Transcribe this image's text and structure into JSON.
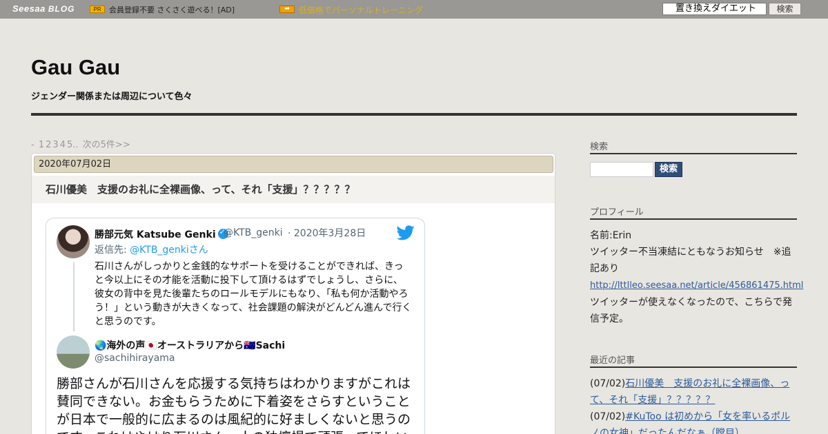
{
  "topbar": {
    "logo_main": "Seesaa",
    "logo_blog": "BLOG",
    "pr_badge": "PR",
    "pr_text": "会員登録不要 さくさく遊べる！[AD]",
    "arrow_badge": "➡",
    "arrow_link": "低価格でパーソナルトレーニング",
    "search_value": "置き換えダイエット",
    "search_button": "検索"
  },
  "header": {
    "title": "Gau Gau",
    "description": "ジェンダー関係または周辺について色々"
  },
  "pager": {
    "dash": "-",
    "pages": [
      "1",
      "2",
      "3",
      "4",
      "5.."
    ],
    "next": "次の5件>>"
  },
  "article": {
    "date": "2020年07月02日",
    "title": "石川優美　支援のお礼に全裸画像、って、それ「支援」？？？？？",
    "tweet": {
      "name": "勝部元気 Katsube Genki",
      "handle": "@KTB_genki",
      "date": "· 2020年3月28日",
      "reply_prefix": "返信先: ",
      "reply_handle": "@KTB_genkiさん",
      "quote_text": "石川さんがしっかりと金銭的なサポートを受けることができれば、きっと今以上にその才能を活動に投下して頂けるはずでしょうし、さらに、彼女の背中を見た後輩たちのロールモデルにもなり、「私も何か活動やろう！」という動きが大きくなって、社会課題の解決がどんどん進んで行くと思うのです。",
      "reply_name": "🌏海外の声🇯🇵オーストラリアから🇦🇺Sachi",
      "reply_user": "@sachihirayama",
      "main_text": "勝部さんが石川さんを応援する気持ちはわかりますがこれは賛同できない。お金もらうために下着姿をさらすということが日本で一般的に広まるのは風紀的に好ましくないと思うのです。これはやはり石川さん一人の独壇場で頑張ってほしい"
    }
  },
  "sidebar": {
    "search_heading": "検索",
    "search_button": "検索",
    "profile_heading": "プロフィール",
    "profile_name": "名前:Erin",
    "profile_notice": "ツイッター不当凍結にともなうお知らせ　※追記あり",
    "profile_link": "http://lttlleo.seesaa.net/article/456861475.html",
    "profile_note": "ツイッターが使えなくなったので、こちらで発信予定。",
    "recent_heading": "最近の記事",
    "recent": [
      {
        "date": "(07/02)",
        "title": "石川優美　支援のお礼に全裸画像、って、それ「支援」？？？？？"
      },
      {
        "date": "(07/02)",
        "title": "#KuToo は初めから「女を率いるポルノの女神」だったんだなぁ（瞠目）"
      }
    ]
  },
  "colors": {
    "topbar": "#9a9894",
    "background": "#e8e6e1",
    "link": "#2a5a9a",
    "twitter_blue": "#1d9bf0",
    "sidebar_button": "#2f4f79"
  }
}
